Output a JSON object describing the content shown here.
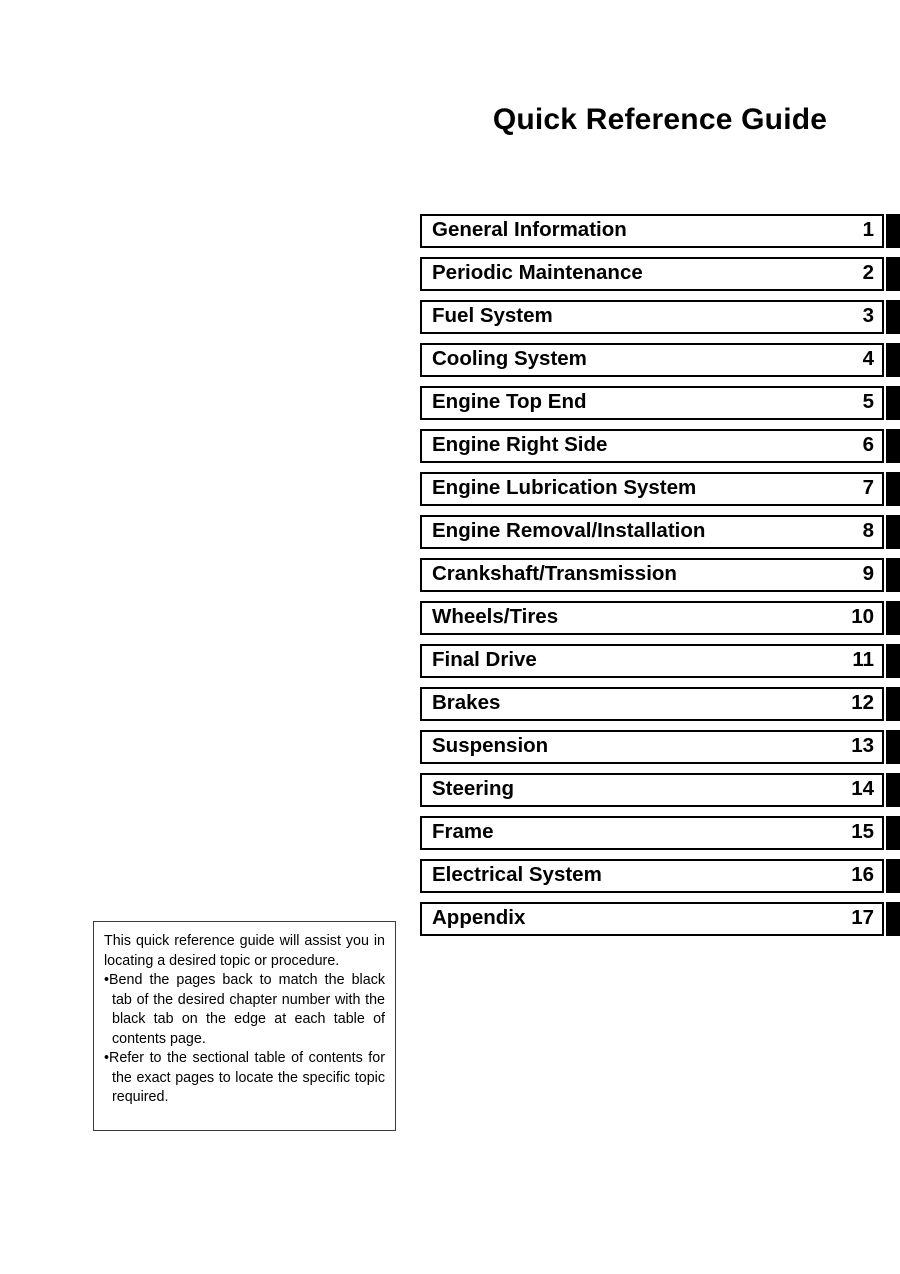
{
  "page": {
    "title": "Quick Reference Guide"
  },
  "chapters": [
    {
      "label": "General Information",
      "number": "1"
    },
    {
      "label": "Periodic Maintenance",
      "number": "2"
    },
    {
      "label": "Fuel System",
      "number": "3"
    },
    {
      "label": "Cooling System",
      "number": "4"
    },
    {
      "label": "Engine Top End",
      "number": "5"
    },
    {
      "label": "Engine Right Side",
      "number": "6"
    },
    {
      "label": "Engine Lubrication System",
      "number": "7"
    },
    {
      "label": "Engine Removal/Installation",
      "number": "8"
    },
    {
      "label": "Crankshaft/Transmission",
      "number": "9"
    },
    {
      "label": "Wheels/Tires",
      "number": "10"
    },
    {
      "label": "Final Drive",
      "number": "11"
    },
    {
      "label": "Brakes",
      "number": "12"
    },
    {
      "label": "Suspension",
      "number": "13"
    },
    {
      "label": "Steering",
      "number": "14"
    },
    {
      "label": "Frame",
      "number": "15"
    },
    {
      "label": "Electrical System",
      "number": "16"
    },
    {
      "label": "Appendix",
      "number": "17"
    }
  ],
  "note": {
    "intro": "This quick reference guide will assist you in locating a desired topic or procedure.",
    "bullets": [
      "Bend the pages back to match the black tab of the desired chapter number with the black tab on the edge at each table of contents page.",
      "Refer to the sectional table of contents for the exact pages to locate the specific topic required."
    ],
    "bullet_mark": "•"
  },
  "colors": {
    "ink": "#000000",
    "tab_black": "#000000",
    "note_border": "#3a3a3a",
    "page_background": "#ffffff"
  }
}
